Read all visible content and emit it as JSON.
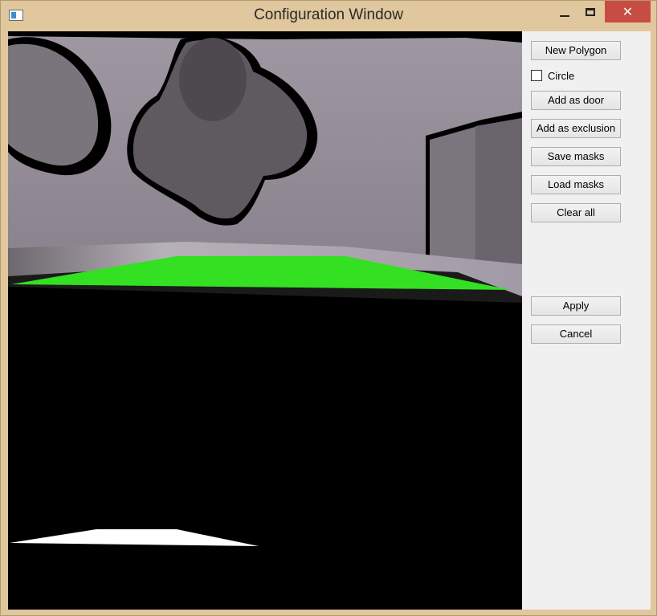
{
  "window": {
    "title": "Configuration Window",
    "close_glyph": "✕"
  },
  "icons": [
    "app-window-icon",
    "minimize-icon",
    "maximize-icon",
    "close-icon"
  ],
  "colors": {
    "door_mask": "#33e022",
    "exclusion_mask": "#ffffff",
    "close_button": "#c74c42",
    "frame": "#e0c79d"
  },
  "panel": {
    "new_polygon": "New Polygon",
    "circle_label": "Circle",
    "circle_checked": false,
    "add_door": "Add as door",
    "add_exclusion": "Add as exclusion",
    "save_masks": "Save masks",
    "load_masks": "Load masks",
    "clear_all": "Clear all",
    "apply": "Apply",
    "cancel": "Cancel"
  }
}
